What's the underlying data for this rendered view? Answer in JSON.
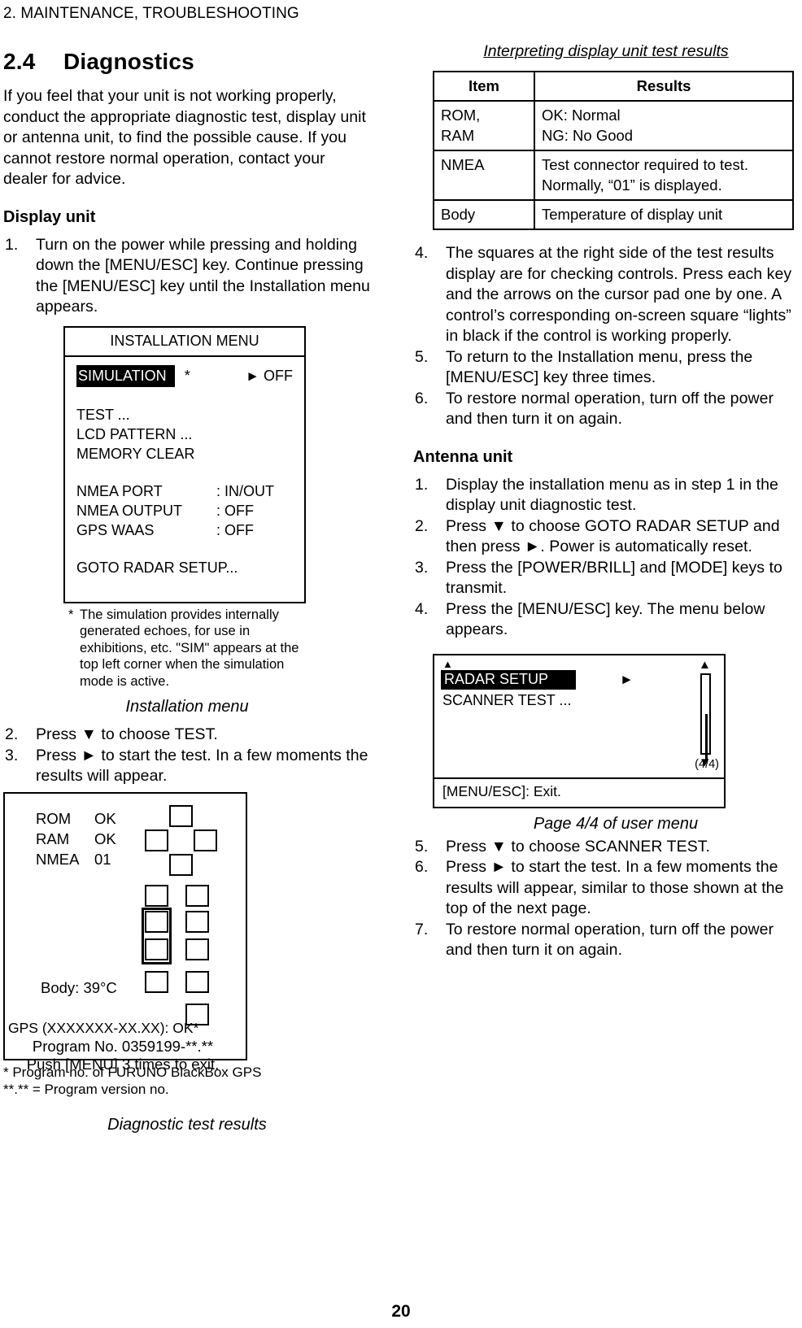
{
  "running_head": "2. MAINTENANCE, TROUBLESHOOTING",
  "page_number": "20",
  "section": {
    "number": "2.4",
    "title": "Diagnostics",
    "intro": "If you feel that your unit is not working properly, conduct the appropriate diagnostic test, display unit or antenna unit, to find the possible cause. If you cannot restore normal operation, contact your dealer for advice."
  },
  "display_unit": {
    "heading": "Display unit",
    "steps": [
      {
        "num": "1.",
        "text": "Turn on the power while pressing and holding down the [MENU/ESC] key. Continue pressing the [MENU/ESC] key until the Installation menu appears."
      },
      {
        "num": "2.",
        "text": "Press ▼ to choose TEST."
      },
      {
        "num": "3.",
        "text": "Press ► to start the test. In a few moments the results will appear."
      }
    ]
  },
  "installation_menu": {
    "title": "INSTALLATION MENU",
    "highlighted_item": "SIMULATION",
    "highlight_star": "*",
    "highlight_arrow": "►",
    "highlight_value": "OFF",
    "plain_items": [
      "TEST ...",
      "LCD PATTERN ...",
      "MEMORY CLEAR"
    ],
    "settings": [
      {
        "key": "NMEA PORT",
        "value": ": IN/OUT"
      },
      {
        "key": "NMEA OUTPUT",
        "value": ": OFF"
      },
      {
        "key": "GPS WAAS",
        "value": ": OFF"
      }
    ],
    "goto_item": "GOTO RADAR SETUP...",
    "footnote_marker": "*",
    "footnote": "The simulation provides internally generated echoes, for use in exhibitions, etc. \"SIM\" appears at the top left corner when the simulation mode is active.",
    "caption": "Installation menu"
  },
  "diagnostic_results": {
    "rows": [
      {
        "label": "ROM",
        "value": "OK"
      },
      {
        "label": "RAM",
        "value": "OK"
      },
      {
        "label": "NMEA",
        "value": "01"
      }
    ],
    "body_temp": "Body: 39°C",
    "gps_line": "GPS (XXXXXXX-XX.XX): OK*",
    "program_no": "Program No. 0359199-**.**",
    "push_line": "Push [MENU] 3 times to exit.",
    "footnotes": [
      "* Program no. of FURUNO BlackBox GPS",
      "**.** = Program version no."
    ],
    "caption": "Diagnostic test results"
  },
  "results_table": {
    "caption": "Interpreting display unit test results",
    "headers": [
      "Item",
      "Results"
    ],
    "rows": [
      {
        "item": "ROM,\nRAM",
        "result": "OK: Normal\nNG: No Good"
      },
      {
        "item": "NMEA",
        "result": "Test connector required to test.\nNormally, “01” is displayed."
      },
      {
        "item": "Body",
        "result": "Temperature of display unit"
      }
    ]
  },
  "display_unit_steps_cont": [
    {
      "num": "4.",
      "text": "The squares at the right side of the test results display are for checking controls. Press each key and the arrows on the cursor pad one by one. A control’s corresponding on-screen square “lights” in black if the control is working properly."
    },
    {
      "num": "5.",
      "text": "To return to the Installation menu, press the [MENU/ESC] key three times."
    },
    {
      "num": "6.",
      "text": "To restore normal operation, turn off the power and then turn it on again."
    }
  ],
  "antenna_unit": {
    "heading": "Antenna unit",
    "steps_before_figure": [
      {
        "num": "1.",
        "text": "Display the installation menu as in step 1 in the display unit diagnostic test."
      },
      {
        "num": "2.",
        "text": "Press ▼ to choose GOTO RADAR SETUP and then press ►. Power is automatically reset."
      },
      {
        "num": "3.",
        "text": "Press the [POWER/BRILL] and [MODE] keys to transmit."
      },
      {
        "num": "4.",
        "text": "Press the [MENU/ESC] key. The menu below appears."
      }
    ],
    "steps_after_figure": [
      {
        "num": "5.",
        "text": "Press ▼ to choose SCANNER TEST."
      },
      {
        "num": "6.",
        "text": "Press ► to start the test. In a few moments the results will appear, similar to those shown at the top of the next page."
      },
      {
        "num": "7.",
        "text": "To restore normal operation, turn off the power and then turn it on again."
      }
    ]
  },
  "radar_setup_menu": {
    "highlighted_item": "RADAR SETUP",
    "arrow": "►",
    "second_item": "SCANNER TEST ...",
    "up_caret": "▲",
    "scroll_up": "▲",
    "scroll_down": "▼",
    "page_indicator": "(4/4)",
    "status_bar": "[MENU/ESC]: Exit.",
    "caption": "Page 4/4 of user menu"
  }
}
